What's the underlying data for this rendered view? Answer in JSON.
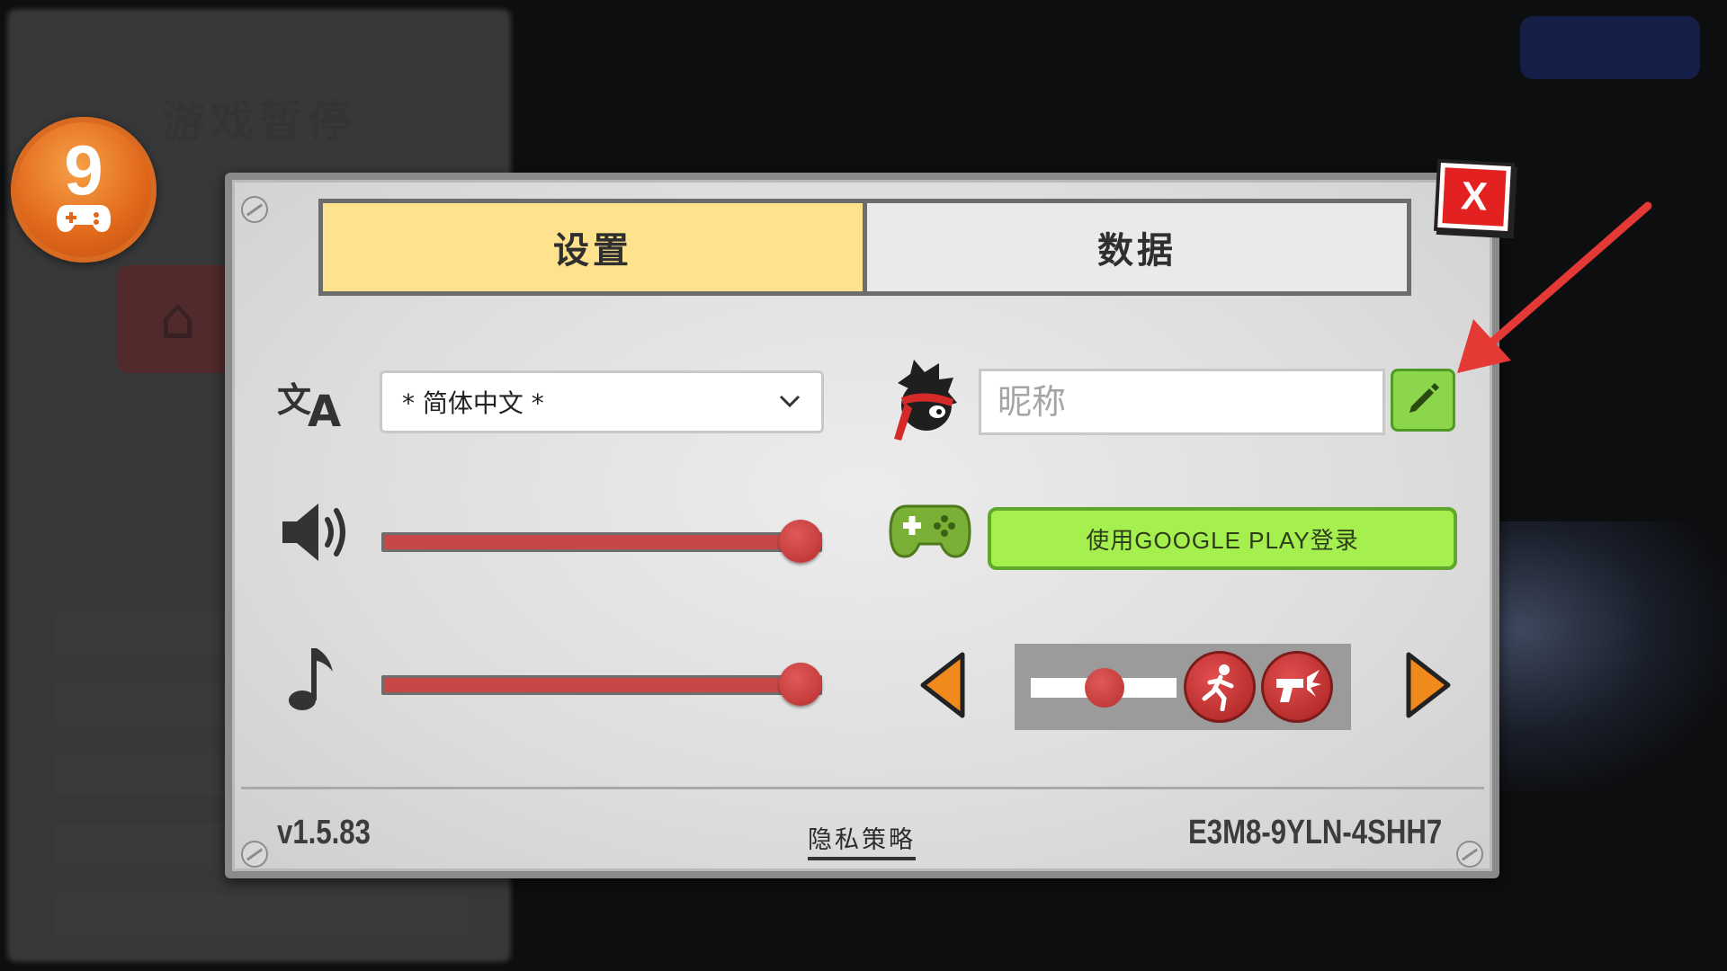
{
  "background": {
    "title": "游戏暂停"
  },
  "badge": {
    "number": "9"
  },
  "tabs": [
    {
      "label": "设置",
      "active": true
    },
    {
      "label": "数据",
      "active": false
    }
  ],
  "settings": {
    "language": {
      "icon": "translate-icon",
      "selected": "* 简体中文 *"
    },
    "sound": {
      "icon": "speaker-icon",
      "level": 1.0
    },
    "music": {
      "icon": "music-note-icon",
      "level": 1.0
    }
  },
  "profile": {
    "avatar_icon": "ninja-avatar-icon",
    "nickname_placeholder": "昵称",
    "nickname_value": "",
    "edit_icon": "pencil-icon"
  },
  "google_play": {
    "icon": "gamepad-icon",
    "label": "使用GOOGLE PLAY登录"
  },
  "controls": {
    "mini_slider_level": 0.5,
    "buttons": [
      "run-icon",
      "shoot-icon"
    ]
  },
  "footer": {
    "version": "v1.5.83",
    "privacy_label": "隐私策略",
    "user_code": "E3M8-9YLN-4SHH7"
  },
  "close_label": "X",
  "colors": {
    "tab_active": "#ffe28d",
    "slider_red": "#c74747",
    "green_button": "#a5ef4f",
    "close_red": "#e32121",
    "arrow_orange": "#f08a1c",
    "annotation_red": "#e53935"
  }
}
